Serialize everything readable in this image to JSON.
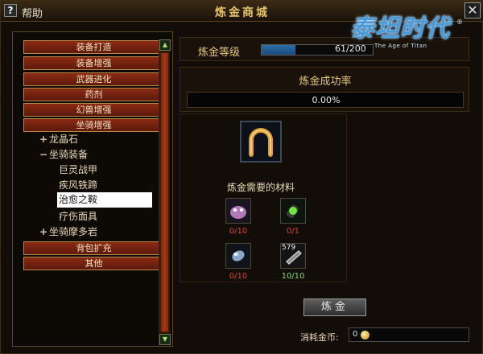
{
  "window": {
    "help_glyph": "?",
    "help_label": "帮助",
    "title": "炼金商城",
    "close_glyph": "✕"
  },
  "logo": {
    "main": "泰坦时代",
    "sub": "The Age of Titan",
    "mark": "®"
  },
  "menu": {
    "top_buttons": [
      "装备打造",
      "装备增强",
      "武器进化",
      "药剂",
      "幻兽增强",
      "坐骑增强"
    ],
    "tree": [
      {
        "sign": "+",
        "label": "龙晶石"
      },
      {
        "sign": "−",
        "label": "坐骑装备"
      }
    ],
    "sub_items": [
      "巨灵战甲",
      "疾风铁蹄",
      "治愈之鞍",
      "疗伤面具"
    ],
    "selected_item": "治愈之鞍",
    "tree_after": {
      "sign": "+",
      "label": "坐骑摩多岩"
    },
    "bottom_buttons": [
      "背包扩充",
      "其他"
    ],
    "scroll_up_glyph": "▲",
    "scroll_down_glyph": "▼"
  },
  "alchemy": {
    "level_label": "炼金等级",
    "level_current": 61,
    "level_max": 200,
    "level_text": "61/200",
    "rate_label": "炼金成功率",
    "rate_text": "0.00%",
    "need_label": "炼金需要的材料",
    "materials": [
      {
        "icon": "creature-icon",
        "count": "0/10",
        "status": "insufficient"
      },
      {
        "icon": "green-potion-icon",
        "count": "0/1",
        "status": "insufficient"
      },
      {
        "icon": "crystal-icon",
        "count": "0/10",
        "status": "insufficient"
      },
      {
        "icon": "scroll-icon",
        "count": "10/10",
        "status": "sufficient",
        "stack": "579"
      }
    ],
    "result_icon": "horseshoe-icon",
    "button_label": "炼金",
    "cost_label": "消耗金币:",
    "cost_value": "0"
  },
  "colors": {
    "insufficient": "#e23a2a",
    "sufficient": "#7fe05a",
    "accent_gold": "#e6c36a",
    "menu_button": "#8a2a14"
  }
}
